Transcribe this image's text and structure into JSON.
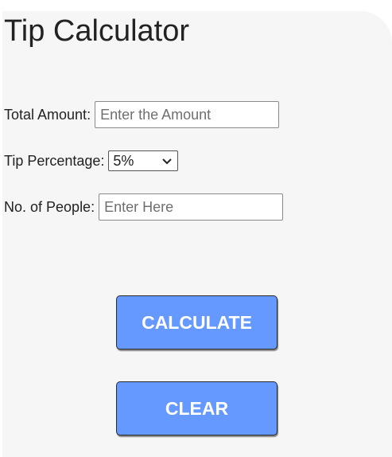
{
  "title": "Tip Calculator",
  "form": {
    "total_label": "Total Amount:",
    "total_placeholder": "Enter the Amount",
    "tip_label": "Tip Percentage:",
    "tip_selected": "5%",
    "people_label": "No. of People:",
    "people_placeholder": "Enter Here"
  },
  "buttons": {
    "calculate": "CALCULATE",
    "clear": "CLEAR"
  },
  "colors": {
    "button_bg": "#6699ff",
    "card_bg": "#f6f6f6"
  }
}
